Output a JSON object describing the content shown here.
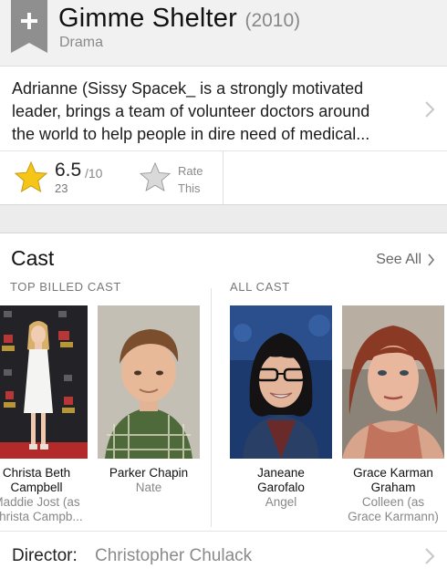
{
  "header": {
    "title": "Gimme Shelter",
    "year": "(2010)",
    "genre": "Drama",
    "add_icon": "plus-ribbon-icon"
  },
  "plot": {
    "text": "Adrianne (Sissy Spacek_ is a strongly motivated\nleader, brings a team of volunteer doctors around\nthe world to help people in dire need of medical..."
  },
  "rating": {
    "value": "6.5",
    "max": "/10",
    "votes": "23",
    "rate_label": "Rate\nThis",
    "star_color": "#f5c518"
  },
  "cast": {
    "title": "Cast",
    "see_all": "See All",
    "top_billed_label": "TOP BILLED CAST",
    "all_cast_label": "ALL CAST",
    "top_billed": [
      {
        "actor": "Christa Beth\nCampbell",
        "character": "Maddie Jost (as\nChrista Campb..."
      },
      {
        "actor": "Parker Chapin",
        "character": "Nate"
      }
    ],
    "all_cast": [
      {
        "actor": "Janeane\nGarofalo",
        "character": "Angel"
      },
      {
        "actor": "Grace Karman\nGraham",
        "character": "Colleen (as\nGrace Karmann)"
      }
    ]
  },
  "director": {
    "label": "Director:",
    "name": "Christopher Chulack"
  }
}
